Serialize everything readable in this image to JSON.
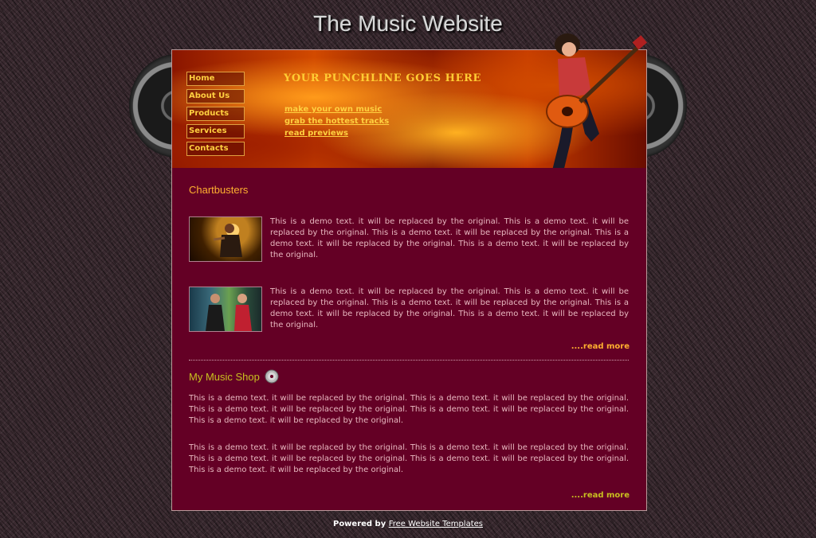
{
  "site": {
    "title": "The Music Website"
  },
  "nav": {
    "items": [
      "Home",
      "About Us",
      "Products",
      "Services",
      "Contacts"
    ]
  },
  "header": {
    "punchline": "YOUR PUNCHLINE GOES HERE",
    "links": [
      "make your own music",
      "grab the hottest tracks",
      "read previews"
    ]
  },
  "chartbusters": {
    "title": "Chartbusters",
    "items": [
      {
        "text": "This is a demo text. it will be replaced by the original. This is a demo text. it will be replaced by the original. This is a demo text. it will be replaced by the original. This is a demo text. it will be replaced by the original. This is a demo text. it will be replaced by the original."
      },
      {
        "text": "This is a demo text. it will be replaced by the original. This is a demo text. it will be replaced by the original. This is a demo text. it will be replaced by the original. This is a demo text. it will be replaced by the original. This is a demo text. it will be replaced by the original."
      }
    ],
    "read_more": "....read more"
  },
  "shop": {
    "title": "My Music Shop",
    "paragraphs": [
      "This is a demo text. it will be replaced by the original. This is a demo text. it will be replaced by the original. This is a demo text. it will be replaced by the original. This is a demo text. it will be replaced by the original. This is a demo text. it will be replaced by the original.",
      "This is a demo text. it will be replaced by the original. This is a demo text. it will be replaced by the original. This is a demo text. it will be replaced by the original. This is a demo text. it will be replaced by the original. This is a demo text. it will be replaced by the original."
    ],
    "read_more": "....read more"
  },
  "footer": {
    "powered_by": "Powered by",
    "link": "Free Website Templates"
  },
  "colors": {
    "content_bg": "#640025",
    "accent_orange": "#ffb030",
    "accent_yellow": "#c8c020",
    "nav_text": "#ffd040"
  },
  "icons": {
    "shop": "cd-disc-icon"
  }
}
